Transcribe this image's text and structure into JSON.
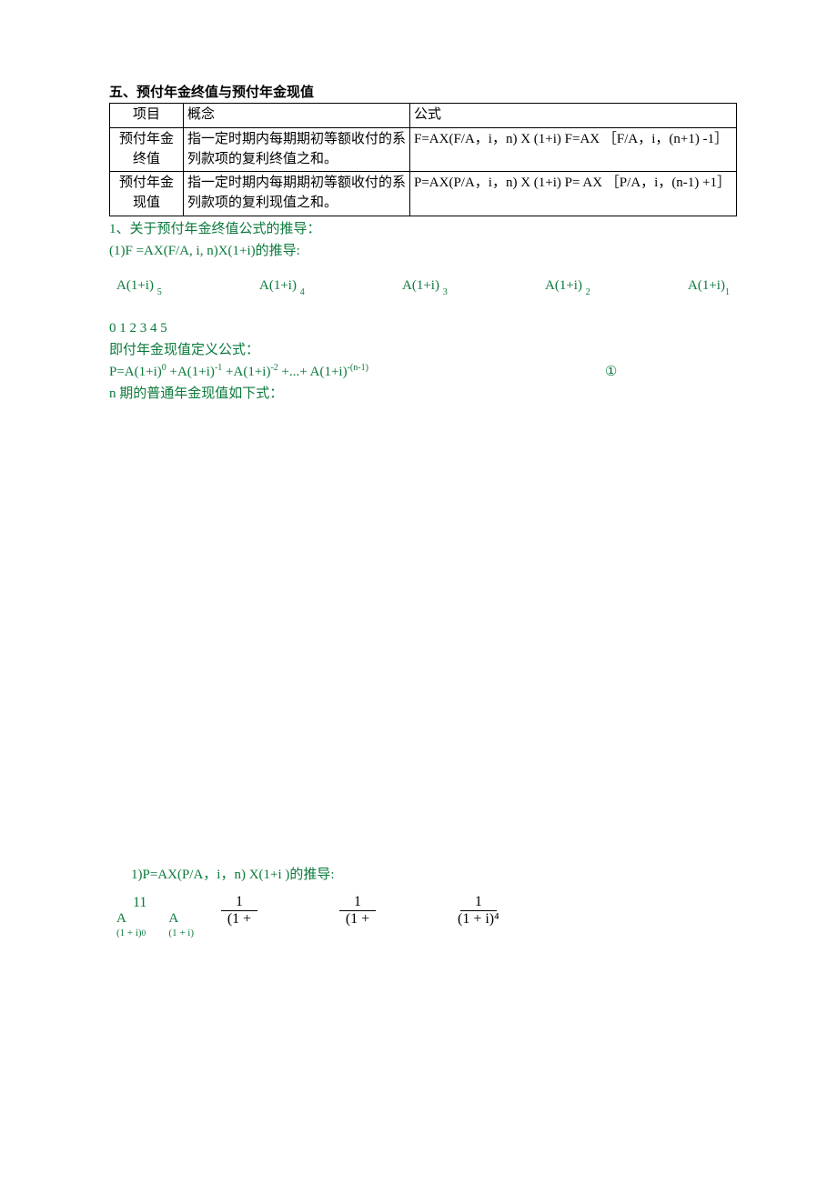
{
  "title": "五、预付年金终值与预付年金现值",
  "table": {
    "header": {
      "c1": "项目",
      "c2": "概念",
      "c3": "公式"
    },
    "rows": [
      {
        "c1": "预付年金终值",
        "c2": "指一定时期内每期期初等额收付的系列款项的复利终值之和。",
        "c3": "F=AX(F/A，i，n) X (1+i) F=AX ［F/A，i，(n+1) -1］"
      },
      {
        "c1": "预付年金现值",
        "c2": "指一定时期内每期期初等额收付的系列款项的复利现值之和。",
        "c3": "P=AX(P/A，i，n) X (1+i) P= AX ［P/A，i，(n-1) +1］"
      }
    ]
  },
  "g1": "1、关于预付年金终值公式的推导：",
  "g2": "(1)F =AX(F/A, i, n)X(1+i)的推导:",
  "terms": {
    "t1_a": "A(1+i)",
    "t1_b": "5",
    "t2_a": "A(1+i)",
    "t2_b": "4",
    "t3_a": "A(1+i)",
    "t3_b": "3",
    "t4_a": "A(1+i)",
    "t4_b": "2",
    "t5_a": "A(1+i)",
    "t5_b": "1"
  },
  "nums": "0 1 2 3 4 5",
  "g3": "即付年金现值定义公式：",
  "g4_pre": "P=A(1+i)",
  "g4_e0": "0",
  "g4_m1": " +A(1+i)",
  "g4_e1": "-1",
  "g4_m2": " +A(1+i)",
  "g4_e2": "-2",
  "g4_m3": " +...+ A(1+i)",
  "g4_e3": "-(n-1)",
  "g4_circ": "①",
  "g5": "n 期的普通年金现值如下式：",
  "g6": "1)P=AX(P/A，i，n)     X(1+i )的推导:",
  "lead": {
    "eleven": "11",
    "A": "A",
    "tiny": "(1 + i)"
  },
  "fracs": {
    "num": "1",
    "d1": "(1 +",
    "d2": "(1 +",
    "d3": "(1 + i)⁴"
  }
}
